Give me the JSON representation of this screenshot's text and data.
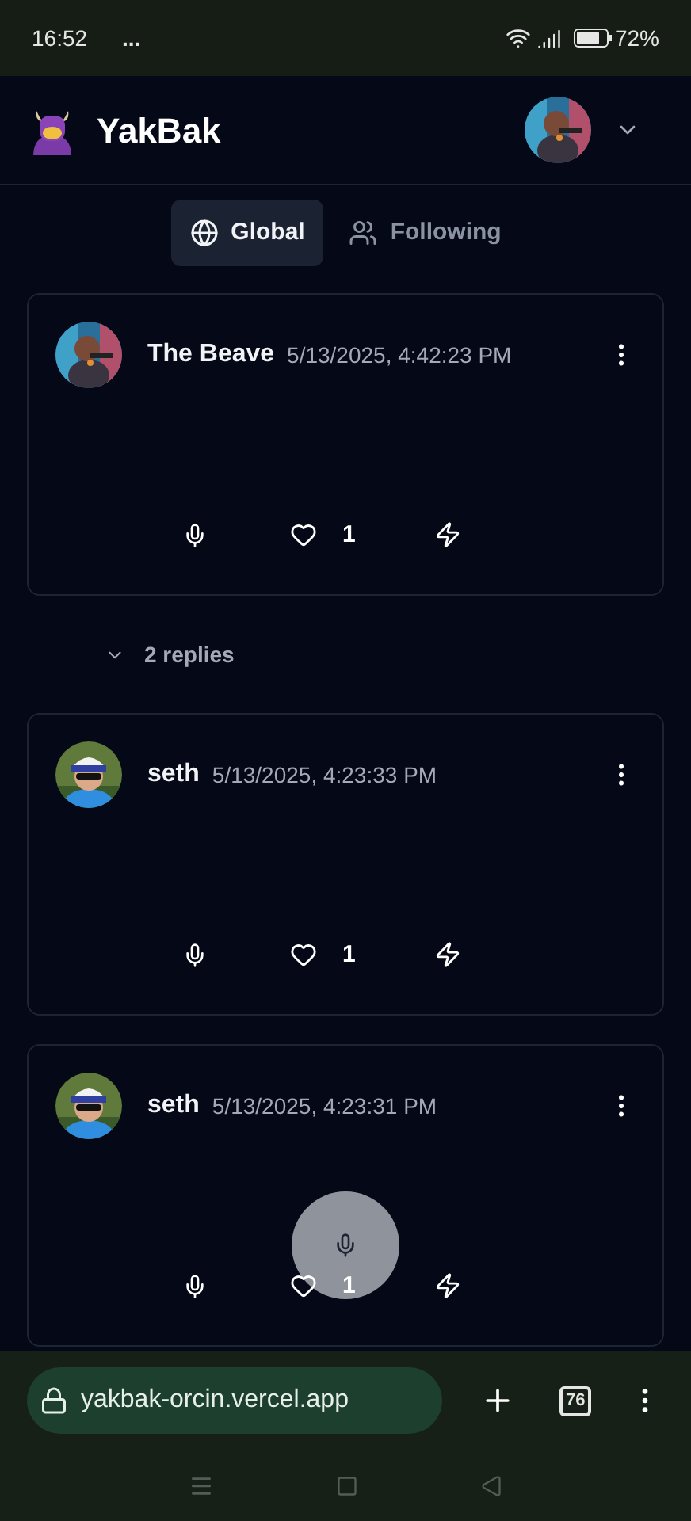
{
  "status_bar": {
    "time": "16:52",
    "notification_more": "...",
    "battery": "72%"
  },
  "header": {
    "title": "YakBak"
  },
  "tabs": [
    {
      "label": "Global",
      "selected": true,
      "kind": "globe"
    },
    {
      "label": "Following",
      "selected": false,
      "kind": "people"
    }
  ],
  "posts": [
    {
      "kind": "post",
      "author": "The Beave",
      "timestamp": "5/13/2025, 4:42:23 PM",
      "likes": "1"
    },
    {
      "kind": "replies",
      "label": "2 replies"
    },
    {
      "kind": "post",
      "author": "seth",
      "timestamp": "5/13/2025, 4:23:33 PM",
      "likes": "1"
    },
    {
      "kind": "post",
      "author": "seth",
      "timestamp": "5/13/2025, 4:23:31 PM",
      "likes": "1"
    }
  ],
  "browser_bar": {
    "url": "yakbak-orcin.vercel.app",
    "tab_count": "76"
  }
}
